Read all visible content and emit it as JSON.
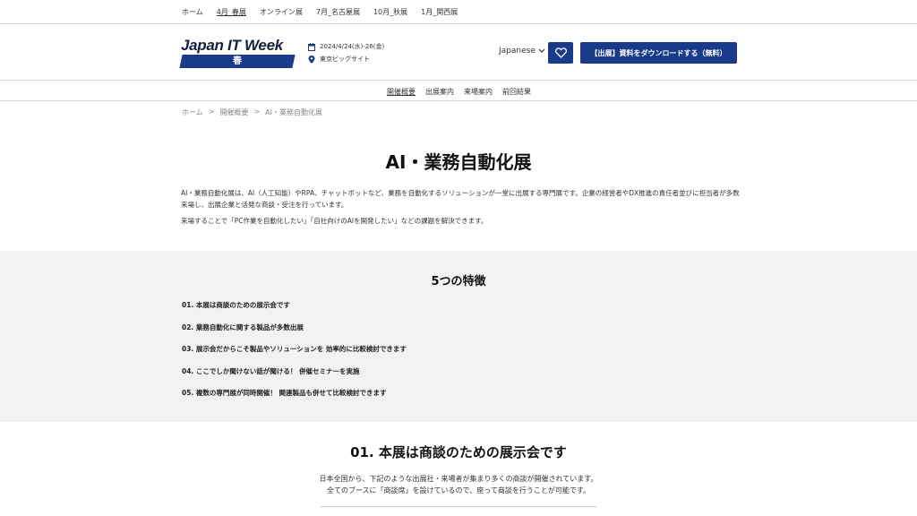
{
  "topnav": {
    "links": [
      "ホーム",
      "4月_春展",
      "オンライン展",
      "7月_名古屋展",
      "10月_秋展",
      "1月_関西展"
    ],
    "active_index": 1
  },
  "header": {
    "logo_text": "Japan IT Week",
    "logo_season": "春",
    "brand_color": "#1a3a8a",
    "event_date": "2024/4/24(水)-26(金)",
    "event_venue": "東京ビッグサイト",
    "language": "Japanese",
    "download_label": "【出展】資料をダウンロードする（無料）"
  },
  "subnav": {
    "items": [
      "開催概要",
      "出展案内",
      "来場案内",
      "前回結果"
    ],
    "active_index": 0
  },
  "breadcrumb": {
    "items": [
      "ホーム",
      "開催概要",
      "AI・業務自動化展"
    ],
    "separator": ">"
  },
  "intro": {
    "title": "AI・業務自動化展",
    "paragraph1": "AI・業務自動化展は、AI（人工知能）やRPA、チャットボットなど、業務を自動化するソリューションが一堂に出展する専門展です。企業の経営者やDX推進の責任者並びに担当者が多数来場し、出展企業と活発な商談・受注を行っています。",
    "paragraph2": "来場することで「PC作業を自動化したい」「自社向けのAIを開発したい」などの課題を解決できます。"
  },
  "features": {
    "title": "5つの特徴",
    "items": [
      "01. 本展は商談のための展示会です",
      "02. 業務自動化に関する製品が多数出展",
      "03. 展示会だからこそ製品やソリューションを 効率的に比較検討できます",
      "04. ここでしか聞けない話が聞ける！ 併催セミナーを実施",
      "05. 複数の専門展が同時開催！ 関連製品も併せて比較検討できます"
    ]
  },
  "section01": {
    "title": "01. 本展は商談のための展示会です",
    "line1": "日本全国から、下記のような出展社・来場者が集まり多くの商談が開催されています。",
    "line2": "全てのブースに「商談席」を設けているので、座って商談を行うことが可能です。"
  }
}
